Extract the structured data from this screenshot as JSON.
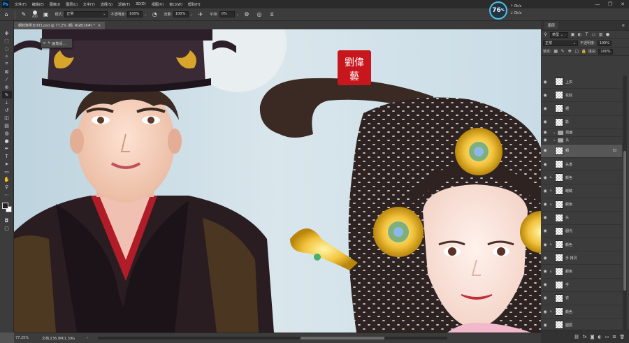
{
  "menu": {
    "app_logo": "Ps",
    "items": [
      "文件(F)",
      "编辑(E)",
      "图像(I)",
      "图层(L)",
      "文字(Y)",
      "选择(S)",
      "滤镜(T)",
      "3D(D)",
      "视图(V)",
      "窗口(W)",
      "帮助(H)"
    ]
  },
  "window_controls": {
    "minimize": "—",
    "restore": "❐",
    "close": "✕"
  },
  "options": {
    "brush_size": "400",
    "mode_label": "模式:",
    "mode_value": "正常",
    "opacity_label": "不透明度:",
    "opacity_value": "100%",
    "flow_label": "流量:",
    "flow_value": "100%",
    "smoothing_label": "平滑:",
    "smoothing_value": "0%"
  },
  "performance": {
    "percent": "76",
    "unit": "%",
    "upload": "0k/s",
    "download": "0k/s"
  },
  "document_tab": {
    "title": "朝鲜族男女003.psd @ 77.2% (帽, RGB/16#) *",
    "close": "×"
  },
  "brush_popup": {
    "label": "画笔设..."
  },
  "seal": {
    "characters": "劉偉藝"
  },
  "status": {
    "zoom": "77.25%",
    "doc_info": "文档:236.8M/1.39G",
    "arrow": "›"
  },
  "layers_panel": {
    "tab_label": "图层",
    "filter_value": "类型",
    "blend_value": "正常",
    "opacity_label": "不透明度:",
    "opacity_value": "100%",
    "lock_label": "锁定:",
    "fill_label": "填充:",
    "fill_value": "100%",
    "layers": [
      {
        "name": "上衣",
        "type": "layer",
        "selected": false,
        "clipped": false
      },
      {
        "name": "花纹",
        "type": "layer",
        "selected": false,
        "clipped": false
      },
      {
        "name": "裙",
        "type": "layer",
        "selected": false,
        "clipped": false
      },
      {
        "name": "影",
        "type": "layer",
        "selected": false,
        "clipped": false
      },
      {
        "name": "前面",
        "type": "group",
        "selected": false,
        "clipped": false
      },
      {
        "name": "头",
        "type": "group",
        "selected": false,
        "clipped": false
      },
      {
        "name": "帽",
        "type": "layer",
        "selected": true,
        "clipped": false
      },
      {
        "name": "头发",
        "type": "layer",
        "selected": false,
        "clipped": false
      },
      {
        "name": "颜色",
        "type": "layer",
        "selected": false,
        "clipped": true
      },
      {
        "name": "眼睛",
        "type": "layer",
        "selected": false,
        "clipped": true
      },
      {
        "name": "颜色",
        "type": "layer",
        "selected": false,
        "clipped": true
      },
      {
        "name": "头",
        "type": "layer",
        "selected": false,
        "clipped": false
      },
      {
        "name": "圆光",
        "type": "layer",
        "selected": false,
        "clipped": false
      },
      {
        "name": "颜色",
        "type": "layer",
        "selected": false,
        "clipped": true
      },
      {
        "name": "手 拷贝",
        "type": "layer",
        "selected": false,
        "clipped": false
      },
      {
        "name": "颜色",
        "type": "layer",
        "selected": false,
        "clipped": true
      },
      {
        "name": "手",
        "type": "layer",
        "selected": false,
        "clipped": false
      },
      {
        "name": "衣",
        "type": "layer",
        "selected": false,
        "clipped": false
      },
      {
        "name": "颜色",
        "type": "layer",
        "selected": false,
        "clipped": true
      },
      {
        "name": "图层",
        "type": "layer",
        "selected": false,
        "clipped": false
      }
    ]
  },
  "colors": {
    "accent": "#4ec0e8",
    "foreground": "#2a1f1f",
    "background": "#ffffff",
    "seal_red": "#c8161d"
  }
}
